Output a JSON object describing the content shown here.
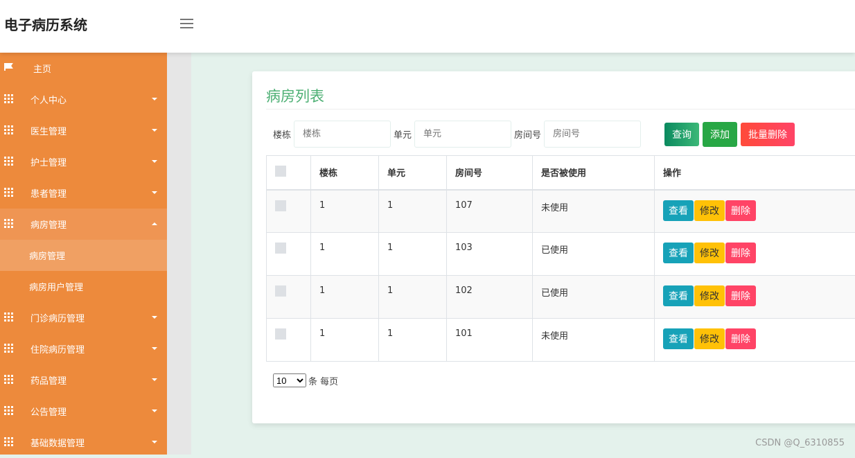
{
  "header": {
    "title": "电子病历系统",
    "menu_icon": "hamburger-icon"
  },
  "sidebar": {
    "items": [
      {
        "label": "主页",
        "icon": "flag-icon"
      },
      {
        "label": "个人中心",
        "icon": "grid-icon"
      },
      {
        "label": "医生管理",
        "icon": "grid-icon"
      },
      {
        "label": "护士管理",
        "icon": "grid-icon"
      },
      {
        "label": "患者管理",
        "icon": "grid-icon"
      },
      {
        "label": "病房管理",
        "icon": "grid-icon",
        "expanded": true,
        "children": [
          {
            "label": "病房管理",
            "active": true
          },
          {
            "label": "病房用户管理"
          }
        ]
      },
      {
        "label": "门诊病历管理",
        "icon": "grid-icon"
      },
      {
        "label": "住院病历管理",
        "icon": "grid-icon"
      },
      {
        "label": "药品管理",
        "icon": "grid-icon"
      },
      {
        "label": "公告管理",
        "icon": "grid-icon"
      },
      {
        "label": "基础数据管理",
        "icon": "grid-icon"
      }
    ]
  },
  "main": {
    "title": "病房列表",
    "search": {
      "building_label": "楼栋",
      "building_placeholder": "楼栋",
      "unit_label": "单元",
      "unit_placeholder": "单元",
      "room_label": "房间号",
      "room_placeholder": "房间号",
      "query": "查询",
      "add": "添加",
      "batch_delete": "批量删除"
    },
    "table": {
      "headers": [
        "楼栋",
        "单元",
        "房间号",
        "是否被使用",
        "操作"
      ],
      "rows": [
        [
          "1",
          "1",
          "107",
          "未使用"
        ],
        [
          "1",
          "1",
          "103",
          "已使用"
        ],
        [
          "1",
          "1",
          "102",
          "已使用"
        ],
        [
          "1",
          "1",
          "101",
          "未使用"
        ]
      ],
      "actions": {
        "view": "查看",
        "edit": "修改",
        "delete": "删除"
      }
    },
    "pager": {
      "page_size": "10",
      "suffix": "条 每页"
    }
  },
  "watermark": "CSDN @Q_6310855",
  "colors": {
    "sidebar": "#ed8a3c",
    "title": "#4caf73",
    "view": "#17a2b8",
    "edit": "#ffc107",
    "delete": "#ff4466",
    "add": "#28a745"
  }
}
